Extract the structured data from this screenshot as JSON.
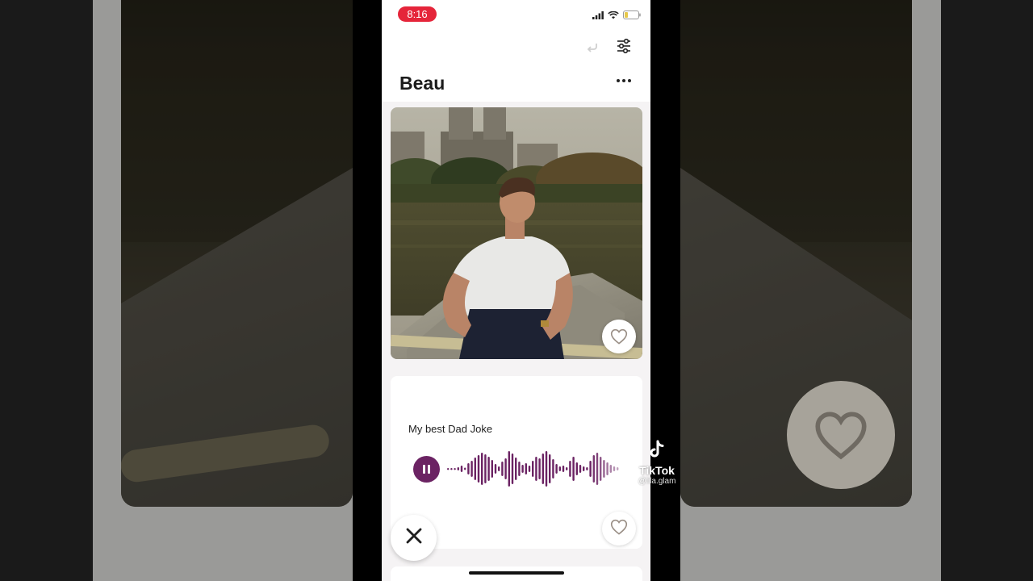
{
  "status_bar": {
    "time": "8:16"
  },
  "profile": {
    "name": "Beau"
  },
  "voice_prompt": {
    "title": "My best Dad Joke"
  },
  "watermark": {
    "brand": "TikTok",
    "handle": "@lila.glam"
  },
  "icons": {
    "undo": "undo-icon",
    "filter": "filter-sliders-icon",
    "more": "more-dots-icon",
    "like": "heart-icon",
    "pause": "pause-icon",
    "close": "close-x-icon",
    "signal": "signal-icon",
    "wifi": "wifi-icon",
    "battery": "battery-icon",
    "tiktok_logo": "tiktok-logo-icon"
  },
  "colors": {
    "accent": "#6b2363",
    "time_pill": "#e5253a",
    "background": "#f5f3f4"
  }
}
